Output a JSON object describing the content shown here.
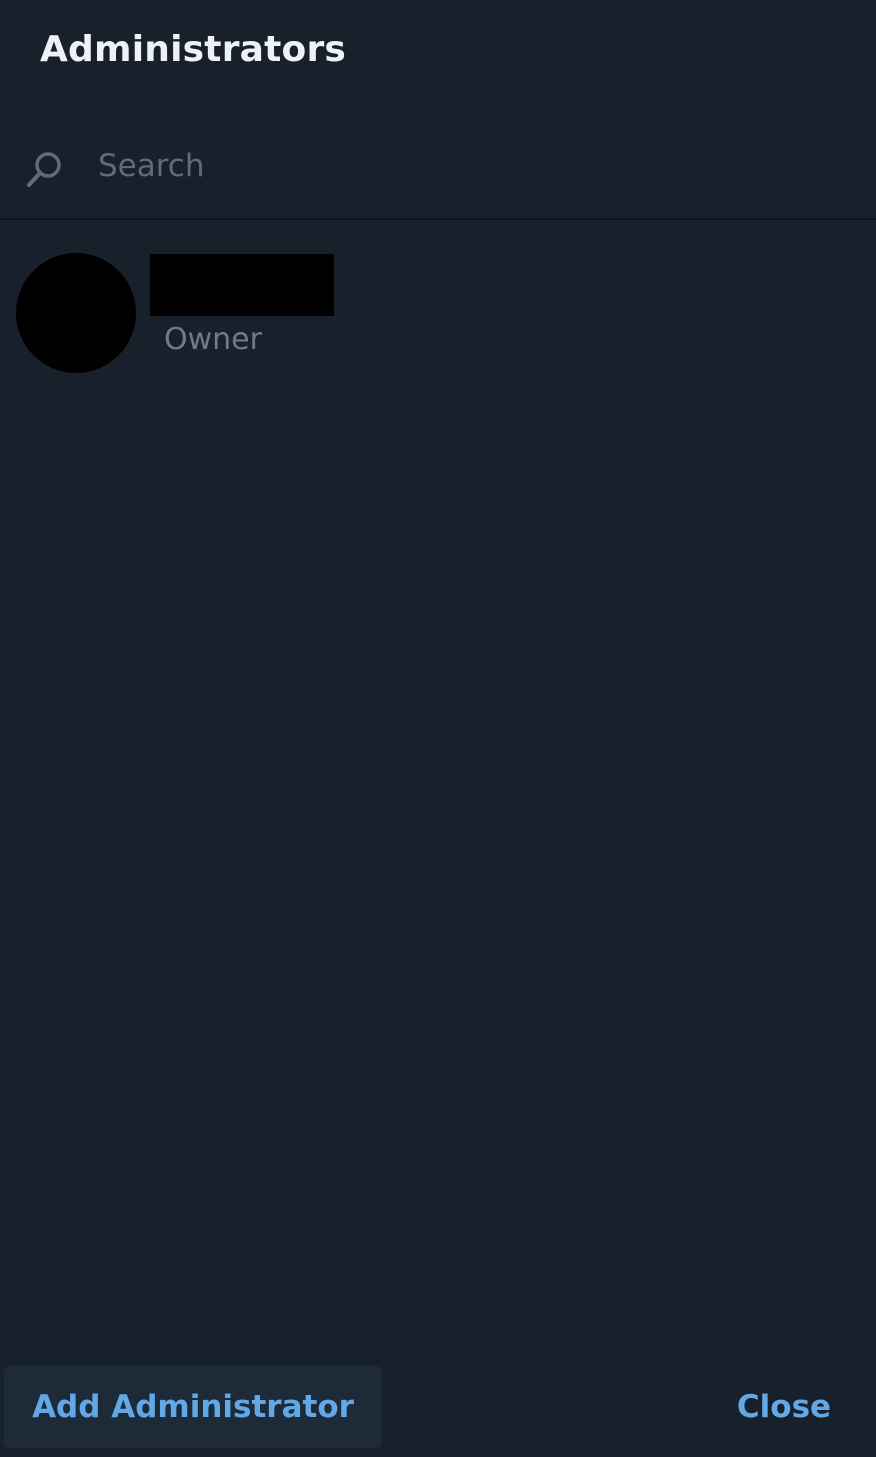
{
  "dialog": {
    "title": "Administrators"
  },
  "search": {
    "placeholder": "Search",
    "value": "",
    "icon": "search-icon"
  },
  "administrators": [
    {
      "avatar": "redacted",
      "name": "",
      "role": "Owner"
    }
  ],
  "footer": {
    "add_label": "Add Administrator",
    "close_label": "Close"
  },
  "colors": {
    "background": "#18202b",
    "accent": "#62a8e6",
    "muted_text": "#6f7c88",
    "button_bg": "#1d2a38"
  }
}
